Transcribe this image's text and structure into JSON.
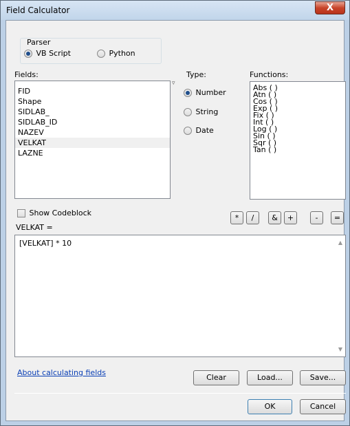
{
  "window": {
    "title": "Field Calculator",
    "close_label": "X"
  },
  "parser": {
    "group_label": "Parser",
    "options": [
      {
        "label": "VB Script",
        "selected": true
      },
      {
        "label": "Python",
        "selected": false
      }
    ]
  },
  "fields": {
    "label": "Fields:",
    "items": [
      "FID",
      "Shape",
      "SIDLAB_",
      "SIDLAB_ID",
      "NAZEV",
      "VELKAT",
      "LAZNE"
    ],
    "selected": "VELKAT"
  },
  "type": {
    "label": "Type:",
    "options": [
      {
        "label": "Number",
        "selected": true
      },
      {
        "label": "String",
        "selected": false
      },
      {
        "label": "Date",
        "selected": false
      }
    ]
  },
  "functions": {
    "label": "Functions:",
    "items": [
      "Abs ( )",
      "Atn ( )",
      "Cos ( )",
      "Exp ( )",
      "Fix ( )",
      "Int ( )",
      "Log ( )",
      "Sin ( )",
      "Sqr ( )",
      "Tan ( )"
    ]
  },
  "codeblock": {
    "label": "Show Codeblock",
    "checked": false
  },
  "operators": [
    "*",
    "/",
    "&",
    "+",
    "-",
    "="
  ],
  "expression": {
    "label": "VELKAT =",
    "value": "[VELKAT] * 10"
  },
  "links": {
    "about": "About calculating fields"
  },
  "buttons": {
    "clear": "Clear",
    "load": "Load...",
    "save": "Save...",
    "ok": "OK",
    "cancel": "Cancel"
  }
}
